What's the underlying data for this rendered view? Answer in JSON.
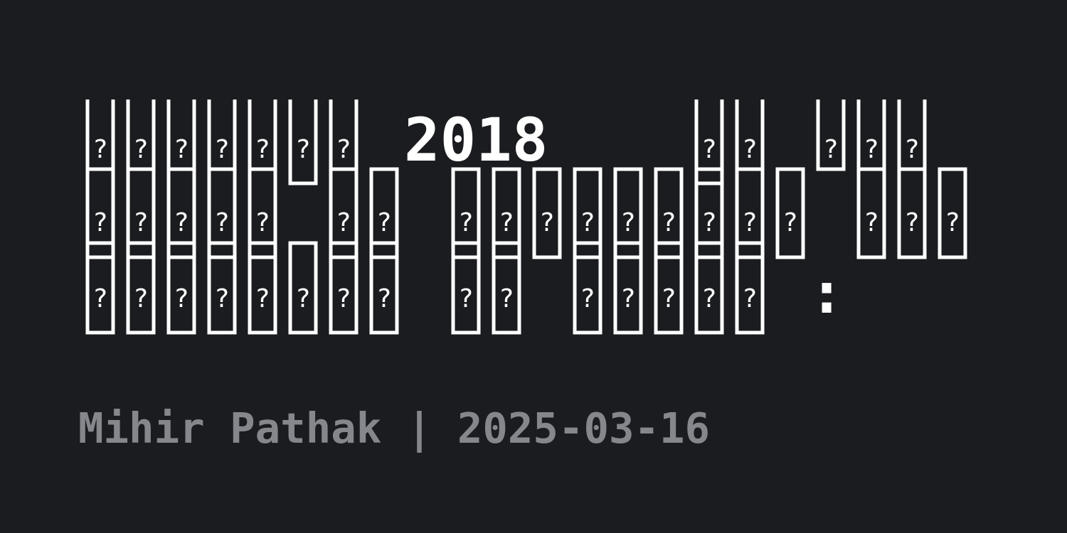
{
  "title": {
    "placeholder_glyph": "?",
    "year": "2018",
    "colon": ":"
  },
  "byline": {
    "author": "Mihir Pathak",
    "separator": "|",
    "date": "2025-03-16"
  },
  "colors": {
    "background": "#1b1c20",
    "title_text": "#ffffff",
    "byline_text": "#86878d"
  }
}
